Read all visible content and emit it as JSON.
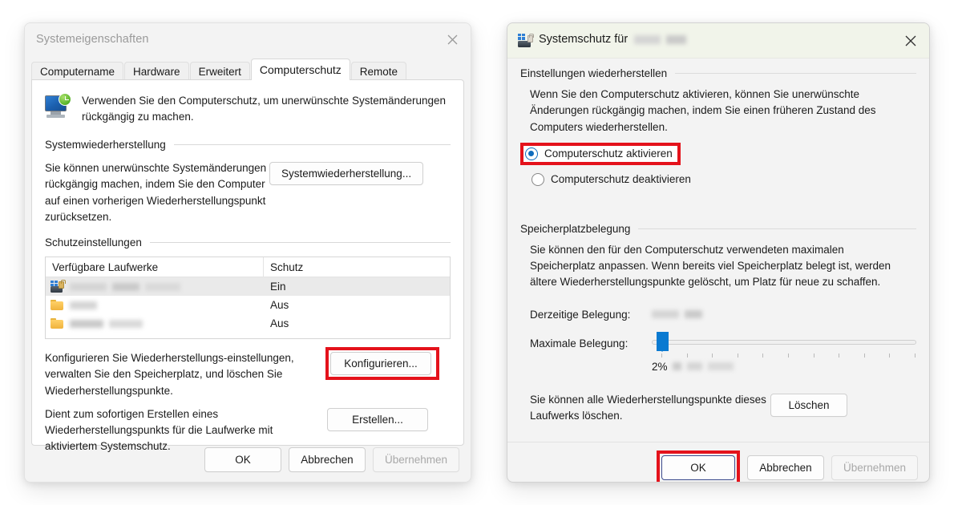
{
  "colors": {
    "accent_blue": "#0f6cbd",
    "slider_blue": "#0a7ad1",
    "highlight_red": "#e4121b",
    "title_active_bg": "#f1f4ea",
    "dialog_bg": "#f3f3f3"
  },
  "left_dialog": {
    "title": "Systemeigenschaften",
    "close_icon": "close-icon",
    "tabs": [
      {
        "label": "Computername",
        "active": false
      },
      {
        "label": "Hardware",
        "active": false
      },
      {
        "label": "Erweitert",
        "active": false
      },
      {
        "label": "Computerschutz",
        "active": true
      },
      {
        "label": "Remote",
        "active": false
      }
    ],
    "intro": {
      "icon": "computer-protection-icon",
      "text": "Verwenden Sie den Computerschutz, um unerwünschte Systemänderungen rückgängig zu machen."
    },
    "restore_section": {
      "heading": "Systemwiederherstellung",
      "text": "Sie können unerwünschte Systemänderungen rückgängig machen, indem Sie den Computer auf einen vorherigen Wiederherstellungspunkt zurücksetzen.",
      "button": "Systemwiederherstellung..."
    },
    "protection_section": {
      "heading": "Schutzeinstellungen",
      "table": {
        "columns": [
          "Verfügbare Laufwerke",
          "Schutz"
        ],
        "rows": [
          {
            "icon": "drive-locked-icon",
            "name": "",
            "redacted": true,
            "protection": "Ein",
            "selected": true
          },
          {
            "icon": "folder-icon",
            "name": "",
            "redacted": true,
            "protection": "Aus",
            "selected": false
          },
          {
            "icon": "folder-icon",
            "name": "",
            "redacted": true,
            "protection": "Aus",
            "selected": false
          }
        ]
      }
    },
    "configure_row": {
      "text": "Konfigurieren Sie Wiederherstellungs-einstellungen, verwalten Sie den Speicherplatz, und löschen Sie Wiederherstellungspunkte.",
      "button": "Konfigurieren...",
      "highlighted": true
    },
    "create_row": {
      "text": "Dient zum sofortigen Erstellen eines Wiederherstellungspunkts für die Laufwerke mit aktiviertem Systemschutz.",
      "button": "Erstellen..."
    },
    "footer": {
      "ok": "OK",
      "cancel": "Abbrechen",
      "apply": "Übernehmen",
      "apply_disabled": true
    }
  },
  "right_dialog": {
    "title_prefix": "Systemschutz für",
    "title_redacted": true,
    "title_icon": "drive-locked-icon",
    "close_icon": "close-icon",
    "settings_section": {
      "heading": "Einstellungen wiederherstellen",
      "text": "Wenn Sie den Computerschutz aktivieren, können Sie unerwünschte Änderungen rückgängig machen, indem Sie einen früheren Zustand des Computers wiederherstellen.",
      "options": [
        {
          "label": "Computerschutz aktivieren",
          "checked": true,
          "highlighted": true
        },
        {
          "label": "Computerschutz deaktivieren",
          "checked": false,
          "highlighted": false
        }
      ]
    },
    "disk_section": {
      "heading": "Speicherplatzbelegung",
      "text": "Sie können den für den Computerschutz verwendeten maximalen Speicherplatz anpassen. Wenn bereits viel Speicherplatz belegt ist, werden ältere Wiederherstellungspunkte gelöscht, um Platz für neue zu schaffen.",
      "current_usage_label": "Derzeitige Belegung:",
      "current_usage_value": "",
      "current_usage_redacted": true,
      "max_usage_label": "Maximale Belegung:",
      "slider_percent": 2,
      "slider_tick_count": 11,
      "percent_label": "2%",
      "percent_value_redacted": true
    },
    "delete_section": {
      "text": "Sie können alle Wiederherstellungspunkte dieses Laufwerks löschen.",
      "button": "Löschen"
    },
    "footer": {
      "ok": "OK",
      "ok_highlighted": true,
      "ok_focused": true,
      "cancel": "Abbrechen",
      "apply": "Übernehmen",
      "apply_disabled": true
    }
  }
}
